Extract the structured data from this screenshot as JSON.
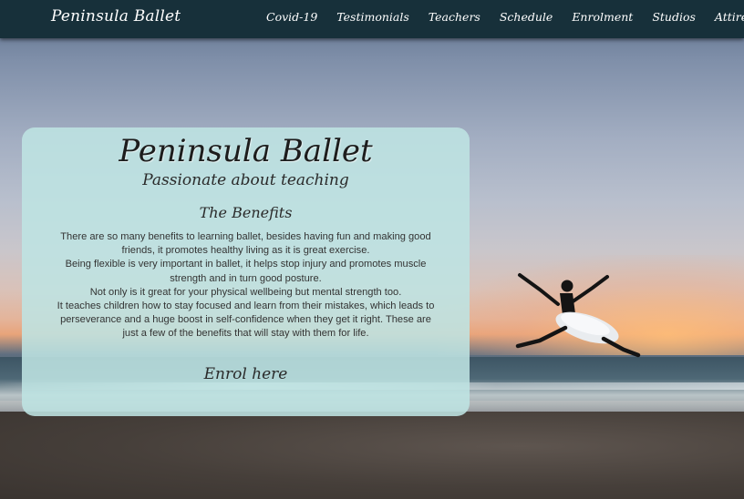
{
  "nav": {
    "brand": "Peninsula Ballet",
    "links": [
      "Covid-19",
      "Testimonials",
      "Teachers",
      "Schedule",
      "Enrolment",
      "Studios",
      "Attire"
    ]
  },
  "hero": {
    "title": "Peninsula Ballet",
    "tagline": "Passionate about teaching",
    "heading": "The Benefits",
    "paragraphs": [
      "There are so many benefits to learning ballet, besides having fun and making good friends, it promotes healthy living as it is great exercise.",
      "Being flexible is very important in ballet, it helps stop injury and promotes muscle strength and in turn good posture.",
      "Not only is it great for your physical wellbeing but mental strength too.",
      "It teaches children how to stay focused and learn from their mistakes, which leads to perseverance and a huge boost in self-confidence when they get it right. These are just a few of the benefits that will stay with them for life."
    ],
    "cta": "Enrol here"
  },
  "colors": {
    "navbar": "#17303a",
    "card": "#bee4e2",
    "text": "#333333"
  },
  "icons": {
    "background": "beach-sunset-ballet-dancer-photo"
  }
}
